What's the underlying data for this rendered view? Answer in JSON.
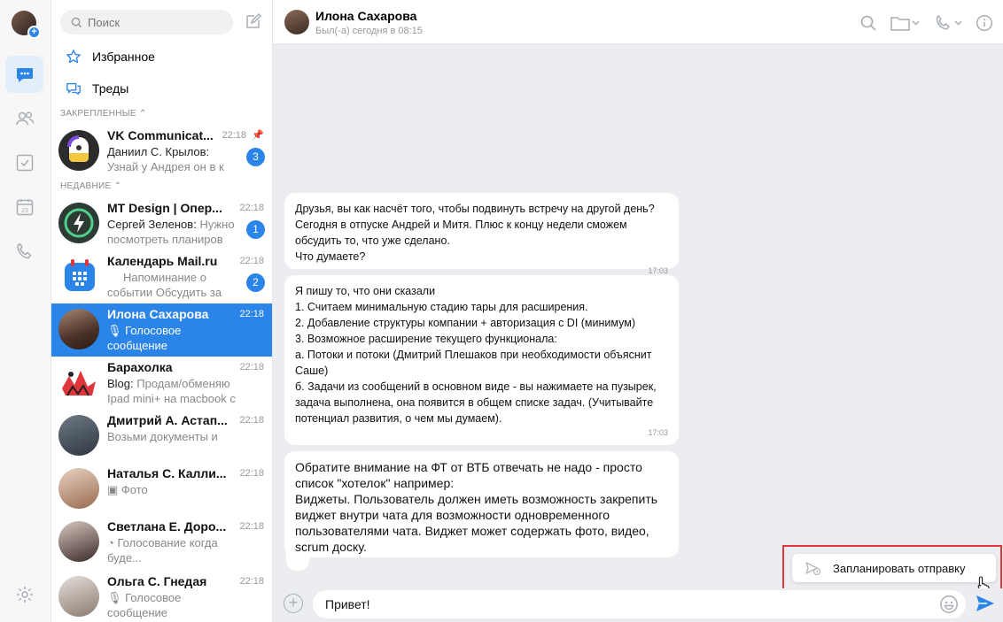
{
  "colors": {
    "accent": "#2b84e8",
    "highlight_frame": "#e0353b",
    "background": "#ebedf0"
  },
  "search": {
    "placeholder": "Поиск"
  },
  "nav": {
    "favorites": "Избранное",
    "threads": "Треды"
  },
  "sections": {
    "pinned": "ЗАКРЕПЛЕННЫЕ",
    "recent": "НЕДАВНИЕ"
  },
  "chats": [
    {
      "title": "VK Communicat...",
      "time": "22:18",
      "sender": "Даниил С. Крылов:",
      "text": "Узнай у Андрея он в к",
      "badge": "3"
    },
    {
      "title": "MT Design | Опер...",
      "time": "22:18",
      "sender": "Сергей Зеленов:",
      "text": "Нужно посмотреть планиров",
      "badge": "1"
    },
    {
      "title": "Календарь Mail.ru",
      "time": "22:18",
      "sender": "",
      "text": "Напоминание о событии Обсудить за",
      "badge": "2"
    },
    {
      "title": "Илона Сахарова",
      "time": "22:18",
      "sender": "",
      "text": "Голосовое сообщение",
      "badge": ""
    },
    {
      "title": "Барахолка",
      "time": "22:18",
      "sender": "Blog:",
      "text": "Продам/обменяю Ipad mini+ на macbook с моей...",
      "badge": ""
    },
    {
      "title": "Дмитрий А. Астап...",
      "time": "22:18",
      "sender": "",
      "text": "Возьми документы и",
      "badge": ""
    },
    {
      "title": "Наталья С. Калли...",
      "time": "22:18",
      "sender": "",
      "text": "Фото",
      "badge": ""
    },
    {
      "title": "Светлана Е. Доро...",
      "time": "22:18",
      "sender": "",
      "text": "Голосование когда буде...",
      "badge": ""
    },
    {
      "title": "Ольга С. Гнедая",
      "time": "22:18",
      "sender": "",
      "text": "Голосовое сообщение",
      "badge": ""
    }
  ],
  "header": {
    "name": "Илона Сахарова",
    "status": "Был(-а) сегодня в 08:15"
  },
  "messages": [
    {
      "text": "Друзья, вы как насчёт того, чтобы подвинуть встречу на другой день? Сегодня в отпуске Андрей и Митя. Плюс к концу недели сможем обсудить то, что уже сделано.\nЧто думаете?",
      "time": "17:03"
    },
    {
      "text": "Я пишу то, что они сказали\n1. Считаем минимальную стадию тары для расширения.\n2. Добавление структуры компании + авторизация с DI (минимум)\n3. Возможное расширение текущего функционала:\nа. Потоки и потоки (Дмитрий Плешаков при необходимости объяснит Саше)\nб. Задачи из сообщений в основном виде - вы нажимаете на пузырек, задача выполнена, она появится в общем списке задач. (Учитывайте потенциал развития, о чем мы думаем).",
      "time": "17:03"
    },
    {
      "text": "Обратите внимание на ФТ от ВТБ отвечать не надо - просто список \"хотелок\" например:\nВиджеты. Пользователь должен иметь возможность закрепить виджет внутри чата для возможности одновременного пользователями чата. Виджет может содержать фото, видео, scrum доску.",
      "time": ""
    }
  ],
  "schedule": {
    "label": "Запланировать отправку"
  },
  "composer": {
    "value": "Привет!"
  }
}
